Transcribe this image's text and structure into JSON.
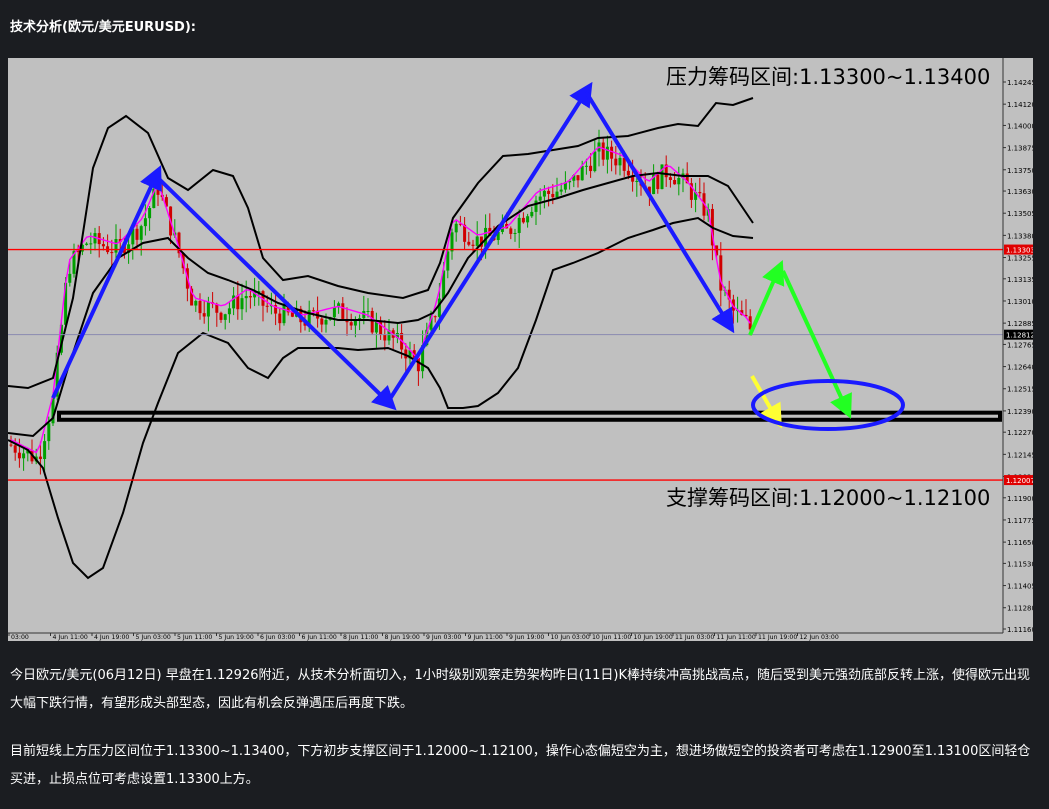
{
  "heading": "技术分析(欧元/美元EURUSD):",
  "chart_data": {
    "type": "candlestick",
    "ylim": [
      1.1116,
      1.143
    ],
    "y_ticks": [
      "1.14245",
      "1.14120",
      "1.14000",
      "1.13875",
      "1.13750",
      "1.13630",
      "1.13505",
      "1.13380",
      "1.13255",
      "1.13135",
      "1.13010",
      "1.12885",
      "1.12765",
      "1.12640",
      "1.12515",
      "1.12390",
      "1.12270",
      "1.12145",
      "1.12020",
      "1.11900",
      "1.11775",
      "1.11650",
      "1.11530",
      "1.11405",
      "1.11280",
      "1.11160"
    ],
    "x_ticks": [
      "4 Jun 03:00",
      "4 Jun 11:00",
      "4 Jun 19:00",
      "5 Jun 03:00",
      "5 Jun 11:00",
      "5 Jun 19:00",
      "6 Jun 03:00",
      "6 Jun 11:00",
      "6 Jun 19:00",
      "7 Jun 03:00",
      "7 Jun 11:00",
      "7 Jun 19:00",
      "8 Jun 03:00",
      "9 Jun 11:00",
      "9 Jun 19:00",
      "10 Jun 03:00",
      "10 Jun 11:00",
      "10 Jun 19:00",
      "11 Jun 03:00",
      "11 Jun 11:00",
      "11 Jun 19:00",
      "12 Jun 03:00"
    ],
    "x_ticks_visible": [
      "03:00",
      "4 Jun 11:00",
      "4 Jun 19:00",
      "5 Jun 03:00",
      "5 Jun 11:00",
      "5 Jun 19:00",
      "6 Jun 03:00",
      "6 Jun 11:00",
      "8 Jun 11:00",
      "8 Jun 19:00",
      "9 Jun 03:00",
      "9 Jun 11:00",
      "9 Jun 19:00",
      "10 Jun 03:00",
      "10 Jun 11:00",
      "10 Jun 19:00",
      "11 Jun 03:00",
      "11 Jun 11:00",
      "11 Jun 19:00",
      "12 Jun 03:00"
    ],
    "resistance_level": 1.133,
    "resistance_tag": "1.13303",
    "support_level": 1.12,
    "support_tag": "1.12007",
    "current_price": 1.1282,
    "current_tag": "1.12812",
    "resistance_label": "压力筹码区间:1.13300~1.13400",
    "support_label": "支撑筹码区间:1.12000~1.12100",
    "support_box": [
      1.1234,
      1.1238
    ],
    "colors": {
      "background": "#c0c0c0",
      "up_candle": "#00a000",
      "down_candle": "#d00000",
      "bands": "#000000",
      "ma": "#ff00ff",
      "level_line": "#ff0000",
      "arrow_blue": "#1a1aff",
      "arrow_green": "#22ff22",
      "arrow_yellow": "#ffff33"
    }
  },
  "paragraph1": "今日欧元/美元(06月12日) 早盘在1.12926附近，从技术分析面切入，1小时级别观察走势架构昨日(11日)K棒持续冲高挑战高点，随后受到美元强劲底部反转上涨，使得欧元出现大幅下跌行情，有望形成头部型态，因此有机会反弹遇压后再度下跌。",
  "paragraph2": "目前短线上方压力区间位于1.13300~1.13400，下方初步支撑区间于1.12000~1.12100，操作心态偏短空为主，想进场做短空的投资者可考虑在1.12900至1.13100区间轻仓买进，止损点位可考虑设置1.13300上方。"
}
